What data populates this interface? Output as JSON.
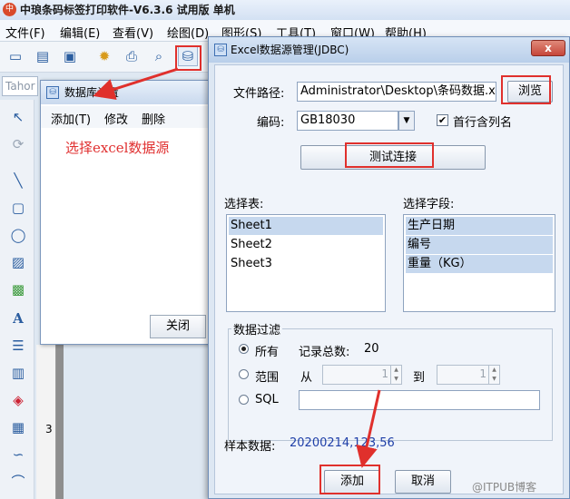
{
  "app": {
    "title": "中琅条码标签打印软件-V6.3.6 试用版 单机",
    "menu": [
      "文件(F)",
      "编辑(E)",
      "查看(V)",
      "绘图(D)",
      "图形(S)",
      "工具(T)",
      "窗口(W)",
      "帮助(H)"
    ],
    "font_box": "Tahor",
    "ruler_number": "3"
  },
  "db_window": {
    "title": "数据库设置",
    "menu": {
      "add": "添加(T)",
      "edit": "修改",
      "delete": "删除"
    },
    "hint": "选择excel数据源",
    "close_button": "关闭"
  },
  "excel_dialog": {
    "title": "Excel数据源管理(JDBC)",
    "close_glyph": "x",
    "file_path_label": "文件路径:",
    "file_path_value": "Administrator\\Desktop\\条码数据.xls",
    "browse_button": "浏览",
    "encoding_label": "编码:",
    "encoding_value": "GB18030",
    "header_checkbox_label": "首行含列名",
    "header_checkbox_checked": true,
    "test_button": "测试连接",
    "select_table_label": "选择表:",
    "tables": [
      "Sheet1",
      "Sheet2",
      "Sheet3"
    ],
    "selected_table": "Sheet1",
    "select_field_label": "选择字段:",
    "fields": [
      "生产日期",
      "编号",
      "重量（KG）"
    ],
    "filter_legend": "数据过滤",
    "filter": {
      "all_label": "所有",
      "record_total_label": "记录总数:",
      "record_total_value": "20",
      "range_label": "范围",
      "from_label": "从",
      "from_value": "1",
      "to_label": "到",
      "to_value": "1",
      "sql_label": "SQL",
      "selected": "all"
    },
    "sample_label": "样本数据:",
    "sample_value": "20200214,123,56",
    "add_button": "添加",
    "cancel_button": "取消"
  },
  "watermark": "@ITPUB博客",
  "colors": {
    "highlight_red": "#e0302c",
    "selection": "#c6d8ee",
    "sample_blue": "#1f3fa8"
  }
}
